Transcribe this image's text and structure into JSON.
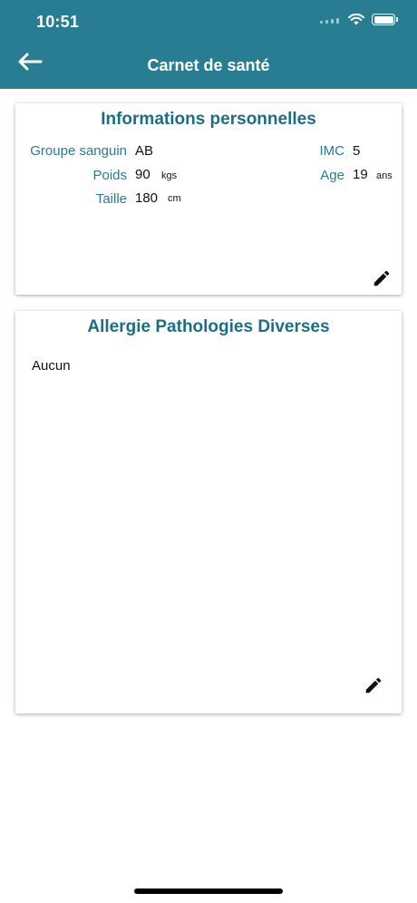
{
  "status_bar": {
    "time": "10:51"
  },
  "header": {
    "title": "Carnet de santé"
  },
  "personal_card": {
    "title": "Informations personnelles",
    "blood_group": {
      "label": "Groupe sanguin",
      "value": "AB"
    },
    "weight": {
      "label": "Poids",
      "value": "90",
      "unit": "kgs"
    },
    "height": {
      "label": "Taille",
      "value": "180",
      "unit": "cm"
    },
    "bmi": {
      "label": "IMC",
      "value": "5"
    },
    "age": {
      "label": "Age",
      "value": "19",
      "unit": "ans"
    }
  },
  "allergy_card": {
    "title": "Allergie Pathologies Diverses",
    "content": "Aucun"
  },
  "colors": {
    "header_bg": "#287d92",
    "title_color": "#1c6e84",
    "label_color": "#2a7a90"
  },
  "icons": [
    "back-arrow-icon",
    "wifi-icon",
    "battery-icon",
    "pencil-icon"
  ]
}
